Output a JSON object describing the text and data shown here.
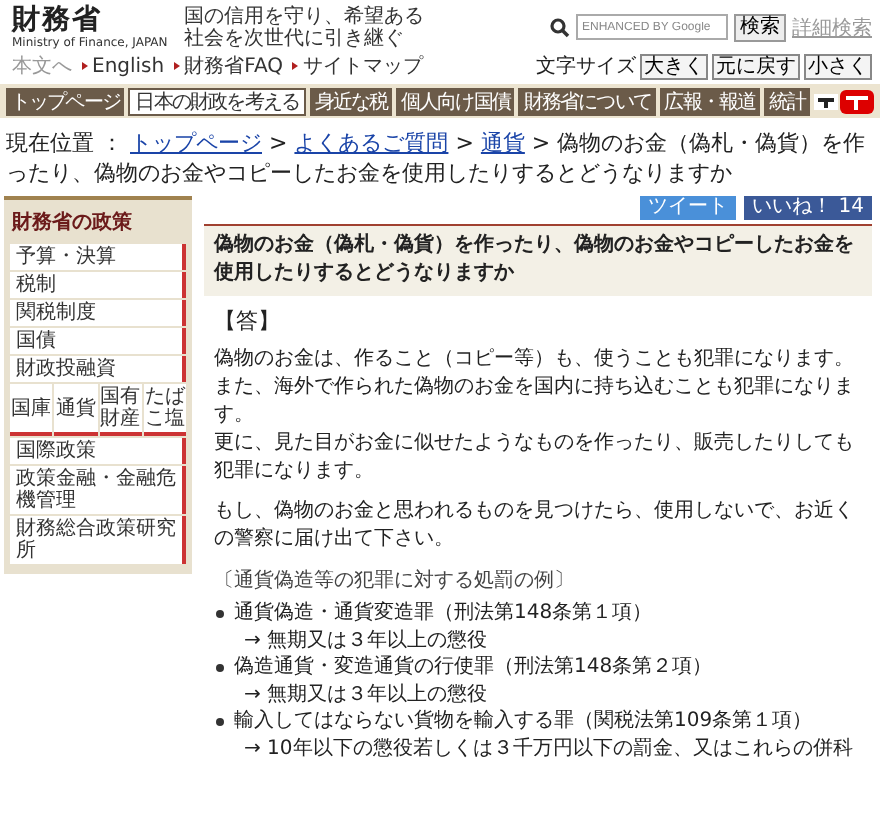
{
  "header": {
    "logo": "財務省",
    "logo_sub": "Ministry of Finance, JAPAN",
    "tagline": "国の信用を守り、希望ある社会を次世代に引き継ぐ",
    "skip_link": "本文へ",
    "links": [
      "English",
      "財務省FAQ",
      "サイトマップ"
    ],
    "search": {
      "placeholder": "ENHANCED BY Google",
      "button": "検索",
      "advanced": "詳細検索"
    },
    "font_size": {
      "label": "文字サイズ",
      "buttons": [
        "大きく",
        "元に戻す",
        "小さく"
      ]
    }
  },
  "nav": [
    {
      "label": "トップページ",
      "highlighted": false
    },
    {
      "label": "日本の財政を考える",
      "highlighted": true
    },
    {
      "label": "身近な税",
      "highlighted": false
    },
    {
      "label": "個人向け国債",
      "highlighted": false
    },
    {
      "label": "財務省について",
      "highlighted": false
    },
    {
      "label": "広報・報道",
      "highlighted": false
    },
    {
      "label": "統計",
      "highlighted": false
    }
  ],
  "breadcrumb": {
    "label": "現在位置 ：",
    "links": [
      "トップページ",
      "よくあるご質問",
      "通貨"
    ],
    "separator": ">",
    "current": "偽物のお金（偽札・偽貨）を作ったり、偽物のお金やコピーしたお金を使用したりするとどうなりますか"
  },
  "sidebar": {
    "title": "財務省の政策",
    "rows": [
      {
        "kind": "item",
        "label": "予算・決算"
      },
      {
        "kind": "item",
        "label": "税制"
      },
      {
        "kind": "item",
        "label": "関税制度"
      },
      {
        "kind": "item",
        "label": "国債"
      },
      {
        "kind": "item",
        "label": "財政投融資"
      },
      {
        "kind": "cells",
        "cells": [
          "国庫",
          "通貨",
          "国有財産",
          "たばこ塩"
        ]
      },
      {
        "kind": "item",
        "label": "国際政策"
      },
      {
        "kind": "item",
        "label": "政策金融・金融危機管理"
      },
      {
        "kind": "item",
        "label": "財務総合政策研究所"
      }
    ]
  },
  "social": {
    "tweet": "ツイート",
    "like": "いいね！ 14"
  },
  "question": "偽物のお金（偽札・偽貨）を作ったり、偽物のお金やコピーしたお金を使用したりするとどうなりますか",
  "answer_heading": "【答】",
  "paragraphs": [
    {
      "lines": [
        "偽物のお金は、作ること（コピー等）も、使うことも犯罪になります。",
        "また、海外で作られた偽物のお金を国内に持ち込むことも犯罪になります。",
        "更に、見た目がお金に似せたようなものを作ったり、販売したりしても犯罪になります。"
      ]
    },
    {
      "lines": [
        "もし、偽物のお金と思われるものを見つけたら、使用しないで、お近くの警察に届け出て下さい。"
      ]
    }
  ],
  "penalties": {
    "title": "〔通貨偽造等の犯罪に対する処罰の例〕",
    "items": [
      {
        "offense": "通貨偽造・通貨変造罪（刑法第148条第１項）",
        "penalty": "→ 無期又は３年以上の懲役"
      },
      {
        "offense": "偽造通貨・変造通貨の行使罪（刑法第148条第２項）",
        "penalty": "→ 無期又は３年以上の懲役"
      },
      {
        "offense": "輸入してはならない貨物を輸入する罪（関税法第109条第１項）",
        "penalty": "→ 10年以下の懲役若しくは３千万円以下の罰金、又はこれらの併科"
      }
    ]
  }
}
